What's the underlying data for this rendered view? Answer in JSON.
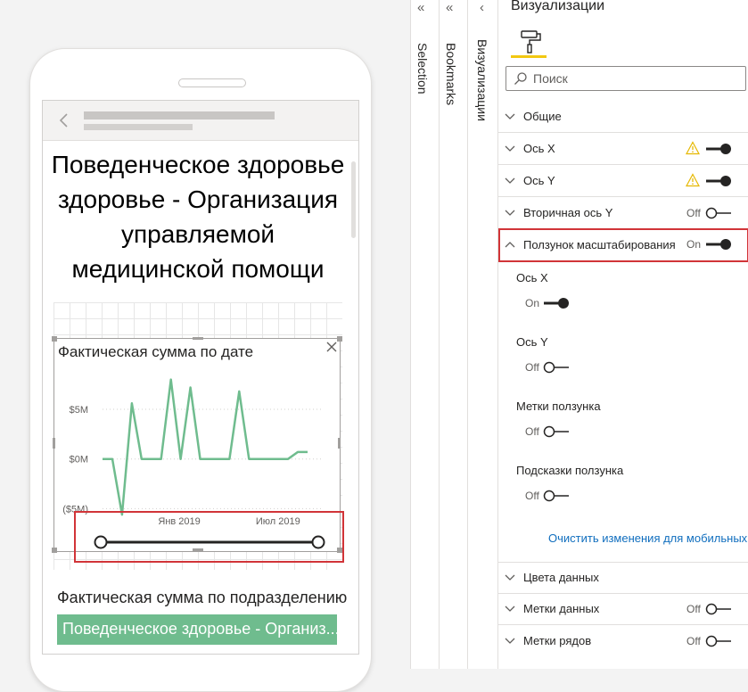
{
  "canvas": {
    "report_title": "Поведенческое здоровье здоровье - Организация управляемой медицинской помощи",
    "visual1_title": "Фактическая сумма по дате",
    "visual2_title": "Фактическая сумма по подразделению",
    "table_row_text": "Поведенческое здоровье - Организ..."
  },
  "chart_data": {
    "type": "line",
    "title": "Фактическая сумма по дате",
    "ytick_labels": [
      "$5M",
      "$0M",
      "($5M)"
    ],
    "yticks": [
      5,
      0,
      -5
    ],
    "ylim": [
      -5.5,
      8.5
    ],
    "xtick_labels": [
      "Янв 2019",
      "Июл 2019"
    ],
    "color": "#6fbc8e",
    "grid": true,
    "series": [
      {
        "values": [
          0,
          0,
          -5.6,
          5.6,
          0,
          0,
          0,
          8,
          0,
          7.2,
          0,
          0,
          0,
          0,
          6.8,
          0,
          0,
          0,
          0,
          0,
          0.7,
          0.7
        ]
      }
    ],
    "zoom_slider": {
      "start": 0,
      "end": 1
    }
  },
  "panes": {
    "selection_label": "Selection",
    "bookmarks_label": "Bookmarks",
    "viz_label": "Визуализации",
    "chevron_double": "«",
    "chevron_single": "‹"
  },
  "viz_pane": {
    "title": "Визуализации",
    "search_placeholder": "Поиск",
    "sections": [
      {
        "label": "Общие"
      },
      {
        "label": "Ось X",
        "toggle": "on",
        "warning": true
      },
      {
        "label": "Ось Y",
        "toggle": "on",
        "warning": true
      },
      {
        "label": "Вторичная ось Y",
        "toggle": "off",
        "state_text": "Off"
      },
      {
        "label": "Ползунок масштабирования",
        "toggle": "on",
        "state_text": "On",
        "expanded": true
      }
    ],
    "zoom_options": [
      {
        "label": "Ось X",
        "state_text": "On"
      },
      {
        "label": "Ось Y",
        "state_text": "Off"
      },
      {
        "label": "Метки ползунка",
        "state_text": "Off"
      },
      {
        "label": "Подсказки ползунка",
        "state_text": "Off"
      }
    ],
    "reset_link": "Очистить изменения для мобильных",
    "bottom_sections": [
      {
        "label": "Цвета данных"
      },
      {
        "label": "Метки данных",
        "toggle": "off",
        "state_text": "Off"
      },
      {
        "label": "Метки рядов",
        "toggle": "off",
        "state_text": "Off"
      }
    ],
    "colors": {
      "accent": "#f2c811",
      "highlight": "#d13438",
      "link": "#106ebe",
      "toggle_track": "#252423"
    }
  }
}
